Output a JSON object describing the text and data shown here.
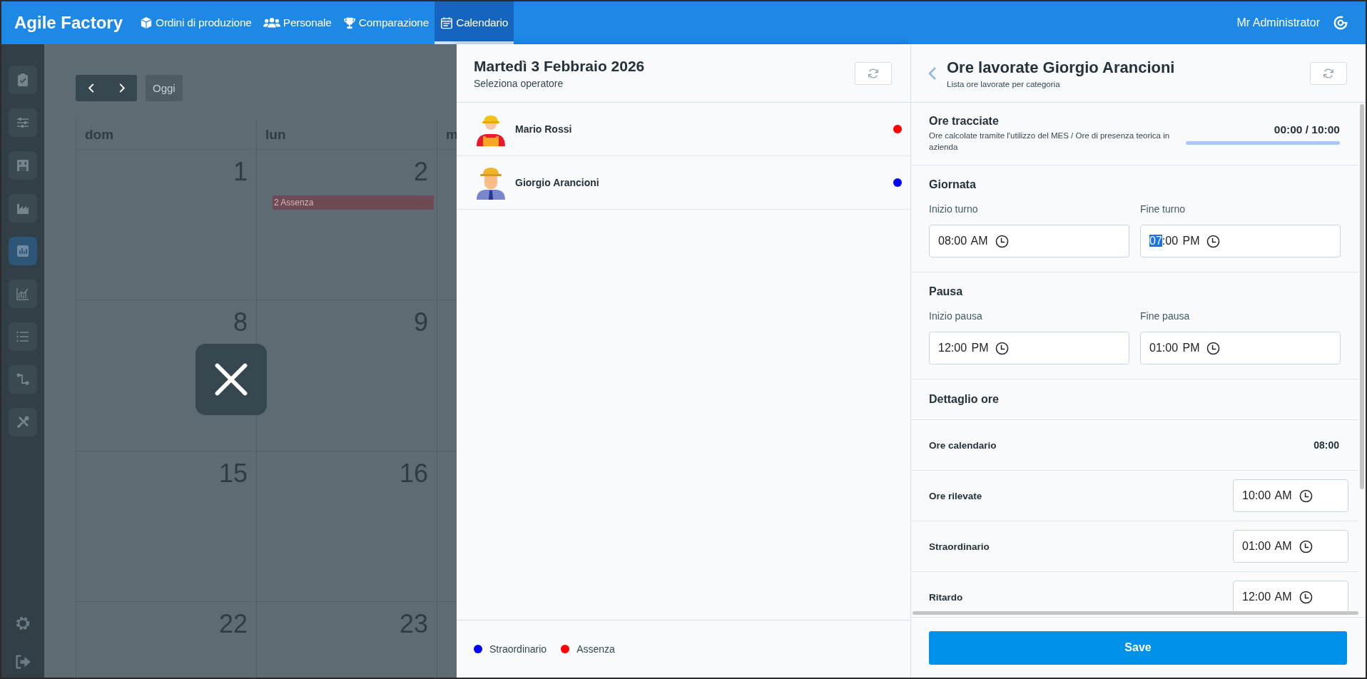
{
  "app": {
    "title": "Agile Factory"
  },
  "nav": [
    {
      "label": "Ordini di produzione",
      "kind": "cube",
      "selected": false
    },
    {
      "label": "Personale",
      "kind": "users",
      "selected": false
    },
    {
      "label": "Comparazione",
      "kind": "trophy",
      "selected": false
    },
    {
      "label": "Calendario",
      "kind": "calendar",
      "selected": true
    }
  ],
  "user": {
    "name": "Mr Administrator"
  },
  "sidebar": {
    "items": [
      {
        "kind": "clipboard",
        "selected": false
      },
      {
        "kind": "sliders",
        "selected": false
      },
      {
        "kind": "building",
        "selected": false
      },
      {
        "kind": "factory",
        "selected": false
      },
      {
        "kind": "bar-chart",
        "selected": true
      },
      {
        "kind": "line-chart",
        "selected": false
      },
      {
        "kind": "list",
        "selected": false
      },
      {
        "kind": "connector",
        "selected": false
      },
      {
        "kind": "tools",
        "selected": false
      }
    ],
    "bottom_items": [
      {
        "kind": "gear"
      },
      {
        "kind": "logout"
      }
    ]
  },
  "calendar": {
    "today_button": "Oggi",
    "weekdays": [
      "dom",
      "lun",
      "m"
    ],
    "weeks": [
      {
        "days": [
          {
            "date": "1"
          },
          {
            "date": "2",
            "events": [
              {
                "label": "2 Assenza"
              }
            ]
          }
        ]
      },
      {
        "days": [
          {
            "date": "8"
          },
          {
            "date": "9"
          }
        ]
      },
      {
        "days": [
          {
            "date": "15"
          },
          {
            "date": "16"
          }
        ]
      },
      {
        "days": [
          {
            "date": "22"
          },
          {
            "date": "23"
          }
        ]
      }
    ]
  },
  "day_panel": {
    "title": "Martedì 3 Febbraio 2026",
    "subtitle": "Seleziona operatore",
    "operators": [
      {
        "name": "Mario Rossi",
        "color": "#ff0000"
      },
      {
        "name": "Giorgio Arancioni",
        "color": "#0000ff"
      }
    ],
    "legend": [
      {
        "label": "Straordinario",
        "color": "#0000ff"
      },
      {
        "label": "Assenza",
        "color": "#ff0000"
      }
    ]
  },
  "hours_panel": {
    "title": "Ore lavorate Giorgio Arancioni",
    "subtitle": "Lista ore lavorate per categoria",
    "tracked": {
      "title": "Ore tracciate",
      "description": "Ore calcolate tramite l'utilizzo del MES / Ore di presenza teorica in azienda",
      "value": "00:00 / 10:00",
      "level": 0
    },
    "sections": [
      {
        "title": "Giornata",
        "fields": [
          {
            "label": "Inizio turno",
            "value": "08:00 AM",
            "focused": false
          },
          {
            "label": "Fine turno",
            "value": "07:00 PM",
            "focused": true
          }
        ]
      },
      {
        "title": "Pausa",
        "fields": [
          {
            "label": "Inizio pausa",
            "value": "12:00 PM",
            "focused": false
          },
          {
            "label": "Fine pausa",
            "value": "01:00 PM",
            "focused": false
          }
        ]
      }
    ],
    "detail": {
      "title": "Dettaglio ore",
      "rows": [
        {
          "kind": "static",
          "label": "Ore calendario",
          "value": "08:00"
        },
        {
          "kind": "time",
          "label": "Ore rilevate",
          "value": "10:00 AM"
        },
        {
          "kind": "time",
          "label": "Straordinario",
          "value": "01:00 AM"
        },
        {
          "kind": "time",
          "label": "Ritardo",
          "value": "12:00 AM"
        }
      ]
    },
    "save_button": "Save"
  }
}
